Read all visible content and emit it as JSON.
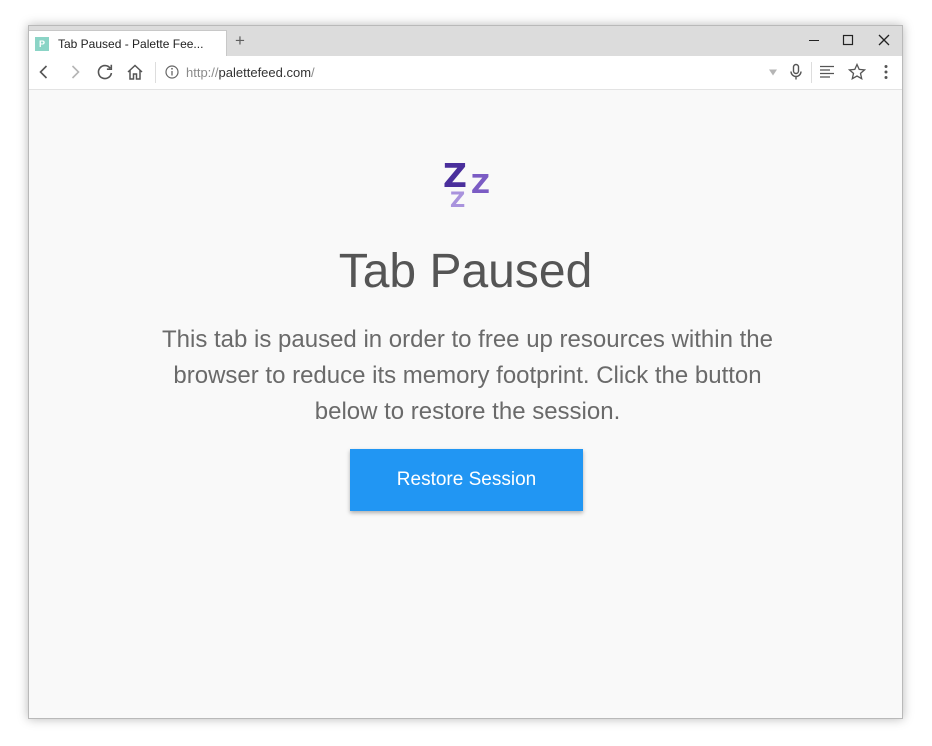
{
  "browser": {
    "tab": {
      "favicon_letter": "P",
      "title": "Tab Paused - Palette Fee..."
    },
    "new_tab_glyph": "+",
    "address": {
      "scheme": "http://",
      "host": "palettefeed.com",
      "rest": "/"
    },
    "icons": {
      "back": "back-arrow-icon",
      "forward": "forward-arrow-icon",
      "reload": "reload-icon",
      "home": "home-icon",
      "site_info": "info-icon",
      "dropdown": "dropdown-triangle-icon",
      "mic": "microphone-icon",
      "reader": "reader-mode-icon",
      "bookmark": "star-icon",
      "menu": "kebab-menu-icon",
      "minimize": "minimize-icon",
      "maximize": "maximize-icon",
      "close": "close-icon"
    }
  },
  "page": {
    "icon": {
      "name": "sleep-zzz-icon",
      "glyphs": [
        "Z",
        "Z",
        "Z"
      ]
    },
    "title": "Tab Paused",
    "description": "This tab is paused in order to free up resources within the browser to reduce its memory footprint. Click the button below to restore the session.",
    "restore_button": "Restore Session"
  },
  "colors": {
    "accent_button": "#2196f3",
    "zzz_dark": "#4a2f9c",
    "zzz_mid": "#7b5cc4",
    "zzz_light": "#a993dd",
    "page_background": "#f9f9f9",
    "favicon": "#8bd4c6"
  }
}
